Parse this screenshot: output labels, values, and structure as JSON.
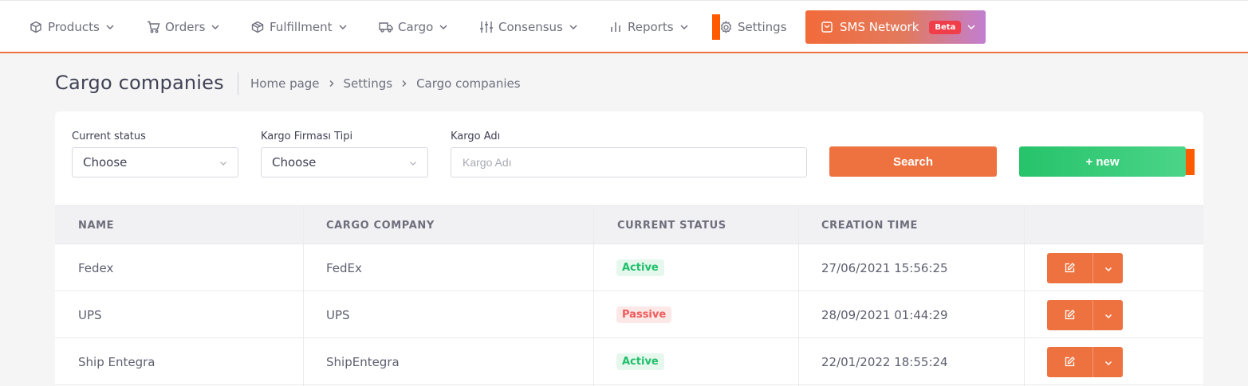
{
  "nav": {
    "items": [
      {
        "label": "Products",
        "icon": "box-icon"
      },
      {
        "label": "Orders",
        "icon": "cart-icon"
      },
      {
        "label": "Fulfillment",
        "icon": "fulfillment-icon"
      },
      {
        "label": "Cargo",
        "icon": "truck-icon"
      },
      {
        "label": "Consensus",
        "icon": "sliders-icon"
      },
      {
        "label": "Reports",
        "icon": "bar-chart-icon"
      },
      {
        "label": "Settings",
        "icon": "gear-icon"
      }
    ],
    "sms": {
      "label": "SMS Network",
      "badge": "Beta",
      "icon": "shopping-bag-icon"
    }
  },
  "page": {
    "title": "Cargo companies",
    "breadcrumb": [
      "Home page",
      "Settings",
      "Cargo companies"
    ]
  },
  "filters": {
    "status": {
      "label": "Current status",
      "value": "Choose"
    },
    "type": {
      "label": "Kargo Firması Tipi",
      "value": "Choose"
    },
    "name": {
      "label": "Kargo Adı",
      "placeholder": "Kargo Adı",
      "value": ""
    },
    "search_label": "Search",
    "new_label": "+ new"
  },
  "table": {
    "headers": [
      "NAME",
      "CARGO COMPANY",
      "CURRENT STATUS",
      "CREATION TIME"
    ],
    "rows": [
      {
        "name": "Fedex",
        "company": "FedEx",
        "status": "Active",
        "status_type": "active",
        "created": "27/06/2021 15:56:25"
      },
      {
        "name": "UPS",
        "company": "UPS",
        "status": "Passive",
        "status_type": "passive",
        "created": "28/09/2021 01:44:29"
      },
      {
        "name": "Ship Entegra",
        "company": "ShipEntegra",
        "status": "Active",
        "status_type": "active",
        "created": "22/01/2022 18:55:24"
      }
    ]
  },
  "colors": {
    "accent": "#ee7240",
    "success": "#26c36a",
    "danger": "#ef5a5a"
  }
}
